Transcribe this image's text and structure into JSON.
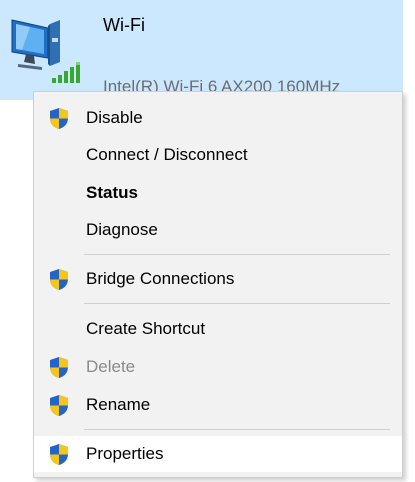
{
  "adapter": {
    "name": "Wi-Fi",
    "device": "Intel(R) Wi-Fi 6 AX200 160MHz",
    "icon": "network-adapter-icon",
    "signal_icon": "wifi-signal-icon"
  },
  "menu": {
    "items": [
      {
        "label": "Disable",
        "icon": "uac-shield-icon"
      },
      {
        "label": "Connect / Disconnect"
      },
      {
        "label": "Status",
        "style": "bold"
      },
      {
        "label": "Diagnose"
      },
      {
        "label": "Bridge Connections",
        "icon": "uac-shield-icon"
      },
      {
        "label": "Create Shortcut"
      },
      {
        "label": "Delete",
        "icon": "uac-shield-icon",
        "state": "disabled"
      },
      {
        "label": "Rename",
        "icon": "uac-shield-icon"
      },
      {
        "label": "Properties",
        "icon": "uac-shield-icon",
        "state": "hover"
      }
    ]
  },
  "colors": {
    "selection": "#cce8ff",
    "menu_background": "#f2f2f2",
    "hover": "#ffffff",
    "shield_blue": "#2463c7",
    "shield_yellow": "#f5c518",
    "disabled_text": "#8a8a8a"
  }
}
